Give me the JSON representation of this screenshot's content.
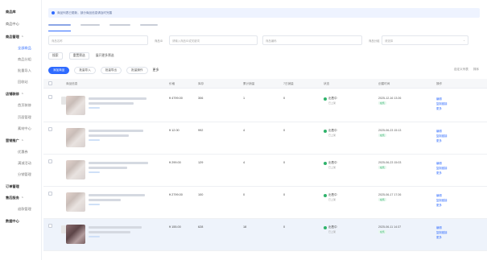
{
  "sidebar": {
    "items": [
      {
        "label": "商品库",
        "type": "group"
      },
      {
        "label": "商品中心",
        "type": "item"
      },
      {
        "label": "商品管理",
        "type": "group"
      },
      {
        "label": "全部商品",
        "type": "sub-active"
      },
      {
        "label": "商品分组",
        "type": "sub"
      },
      {
        "label": "批量导入",
        "type": "sub"
      },
      {
        "label": "回收站",
        "type": "sub"
      },
      {
        "label": "店铺装修",
        "type": "group"
      },
      {
        "label": "首页装修",
        "type": "sub"
      },
      {
        "label": "页面管理",
        "type": "sub"
      },
      {
        "label": "素材中心",
        "type": "sub"
      },
      {
        "label": "营销推广",
        "type": "group"
      },
      {
        "label": "优惠券",
        "type": "sub"
      },
      {
        "label": "满减活动",
        "type": "sub"
      },
      {
        "label": "分销管理",
        "type": "sub"
      },
      {
        "label": "订单管理",
        "type": "group"
      },
      {
        "label": "售后服务",
        "type": "group"
      },
      {
        "label": "退款管理",
        "type": "sub"
      },
      {
        "label": "数据中心",
        "type": "group"
      }
    ]
  },
  "notice": {
    "text": "商品列表已更新，部分商品信息请及时完善"
  },
  "filters": {
    "name_placeholder": "商品名称",
    "id_label": "商品ID",
    "id_placeholder": "请输入商品ID或关键词",
    "code_placeholder": "商品编码",
    "group_label": "商品分组",
    "group_value": "请选择"
  },
  "row2": {
    "search": "搜索",
    "reset": "重置筛选",
    "more": "展开更多筛选"
  },
  "actions": {
    "add": "添加商品",
    "import": "批量导入",
    "export": "批量导出",
    "more": "批量操作",
    "batch": "更多"
  },
  "tools": {
    "settings": "自定义列表",
    "sort": "排序"
  },
  "table": {
    "headers": [
      "商品信息",
      "价格",
      "库存",
      "累计销量",
      "7日销量",
      "状态",
      "创建时间",
      "操作"
    ],
    "rows": [
      {
        "price": "¥ 4799.00",
        "stock": "306",
        "sales": "1",
        "week": "0",
        "status": "出售中",
        "status_sub": "已上架",
        "date": "2025-12-16 13:26",
        "tag": "在售",
        "ops": [
          "编辑",
          "复制链接",
          "更多"
        ]
      },
      {
        "price": "¥ 12.00",
        "stock": "992",
        "sales": "4",
        "week": "0",
        "status": "出售中",
        "status_sub": "已上架",
        "date": "2025-06-23 15:13",
        "tag": "在售",
        "ops": [
          "编辑",
          "复制链接",
          "更多"
        ]
      },
      {
        "price": "¥ 299.00",
        "stock": "129",
        "sales": "4",
        "week": "0",
        "status": "出售中",
        "status_sub": "已上架",
        "date": "2025-06-23 15:03",
        "tag": "在售",
        "ops": [
          "编辑",
          "复制链接",
          "更多"
        ]
      },
      {
        "price": "¥ 2799.00",
        "stock": "100",
        "sales": "0",
        "week": "0",
        "status": "出售中",
        "status_sub": "已上架",
        "date": "2025-06-17 17:26",
        "tag": "在售",
        "ops": [
          "编辑",
          "复制链接",
          "更多"
        ]
      },
      {
        "price": "¥ 155.00",
        "stock": "628",
        "sales": "18",
        "week": "0",
        "status": "出售中",
        "status_sub": "已上架",
        "date": "2025-06-11 14:37",
        "tag": "在售",
        "ops": [
          "编辑",
          "复制链接",
          "更多"
        ]
      }
    ]
  },
  "colors": {
    "accent": "#2f6bff",
    "success": "#2fb36b",
    "highlight_row": "#eef3fb"
  }
}
